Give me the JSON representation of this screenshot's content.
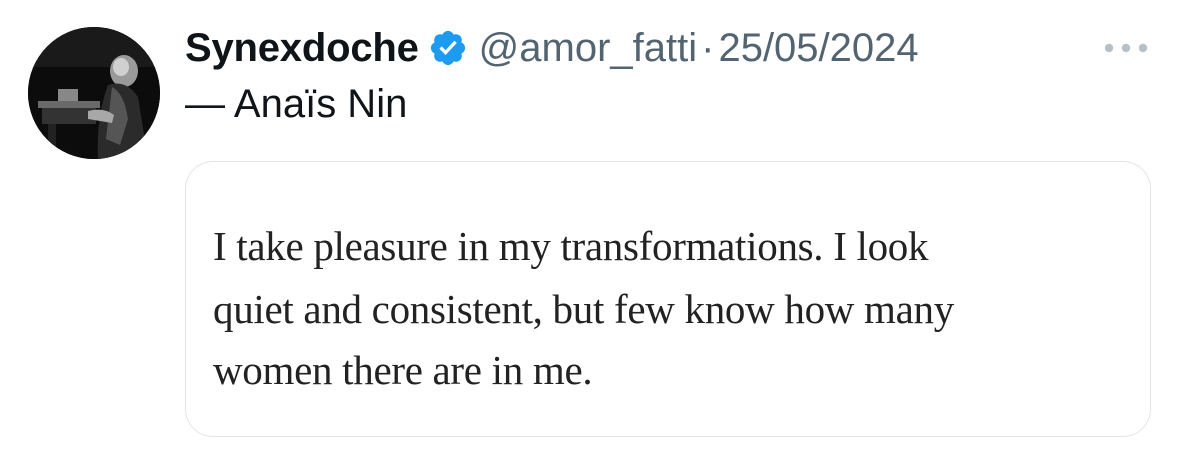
{
  "tweet": {
    "display_name": "Synexdoche",
    "handle": "@amor_fatti",
    "separator": "·",
    "date": "25/05/2024",
    "text": "— Anaïs Nin",
    "verified_icon": "verified-badge-icon",
    "more_icon": "more-options-icon",
    "avatar": "avatar"
  },
  "media": {
    "quote_lines": [
      "I take pleasure in my transformations. I look",
      "quiet and consistent, but few know how many",
      "women there are in me."
    ]
  },
  "colors": {
    "verified_blue": "#1d9bf0",
    "secondary_text": "#536471",
    "primary_text": "#0f1419",
    "card_border": "#e1e5e8"
  }
}
